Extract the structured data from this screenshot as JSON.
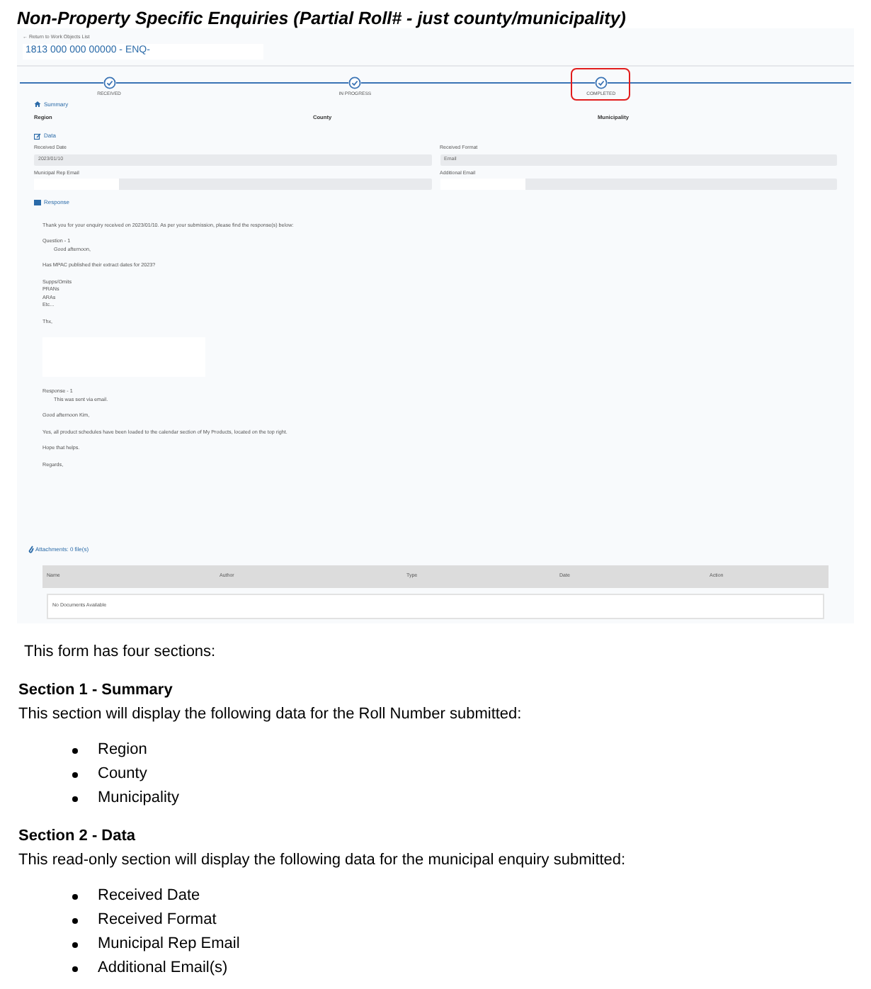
{
  "heading": "Non-Property Specific Enquiries (Partial Roll# - just county/municipality)",
  "app": {
    "back_link": "← Return to Work Objects List",
    "title": "1813 000 000 00000 - ENQ-",
    "steps": [
      {
        "label": "RECEIVED",
        "highlighted": false
      },
      {
        "label": "IN PROGRESS",
        "highlighted": false
      },
      {
        "label": "COMPLETED",
        "highlighted": true
      }
    ],
    "summary": {
      "title": "Summary",
      "columns": [
        "Region",
        "County",
        "Municipality"
      ]
    },
    "data": {
      "title": "Data",
      "fields": [
        {
          "label": "Received Date",
          "value": "2023/01/10"
        },
        {
          "label": "Received Format",
          "value": "Email"
        },
        {
          "label": "Municipal Rep Email"
        },
        {
          "label": "Additional Email"
        }
      ]
    },
    "response": {
      "title": "Response",
      "blocks": [
        {
          "kind": "text",
          "lines": [
            "Thank you for your enquiry received on 2023/01/10.  As per your submission, please find the response(s) below:"
          ]
        },
        {
          "kind": "text",
          "lines": [
            "Question - 1"
          ],
          "indented": [
            "Good afternoon,"
          ]
        },
        {
          "kind": "text",
          "lines": [
            "Has MPAC published their extract dates for 2023?"
          ]
        },
        {
          "kind": "text",
          "lines": [
            "Supps/Omits",
            "PRANs",
            "ARAs",
            "Etc..."
          ]
        },
        {
          "kind": "text",
          "lines": [
            "Thx,"
          ]
        },
        {
          "kind": "redacted"
        },
        {
          "kind": "text",
          "lines": [
            "Response - 1"
          ],
          "indented": [
            "This was sent via email."
          ]
        },
        {
          "kind": "text",
          "lines": [
            "Good afternoon Kim,"
          ]
        },
        {
          "kind": "text",
          "lines": [
            "Yes, all product schedules have been loaded to the calendar section of My Products, located on the top right."
          ]
        },
        {
          "kind": "text",
          "lines": [
            "Hope that helps."
          ]
        },
        {
          "kind": "text",
          "lines": [
            "Regards,"
          ]
        }
      ]
    },
    "attachments": {
      "title": "Attachments: 0 file(s)",
      "columns": [
        "Name",
        "Author",
        "Type",
        "Date",
        "Action"
      ],
      "empty": "No Documents Available"
    }
  },
  "intro": "This form has four sections:",
  "sections": [
    {
      "title": "Section 1 - Summary",
      "text": "This section will display the following data for the Roll Number submitted:",
      "bullets": [
        "Region",
        "County",
        "Municipality"
      ]
    },
    {
      "title": "Section 2 - Data",
      "text": "This read-only section will display the following data for the municipal enquiry submitted:",
      "bullets": [
        "Received Date",
        "Received Format",
        "Municipal Rep Email",
        "Additional Email(s)"
      ]
    }
  ]
}
